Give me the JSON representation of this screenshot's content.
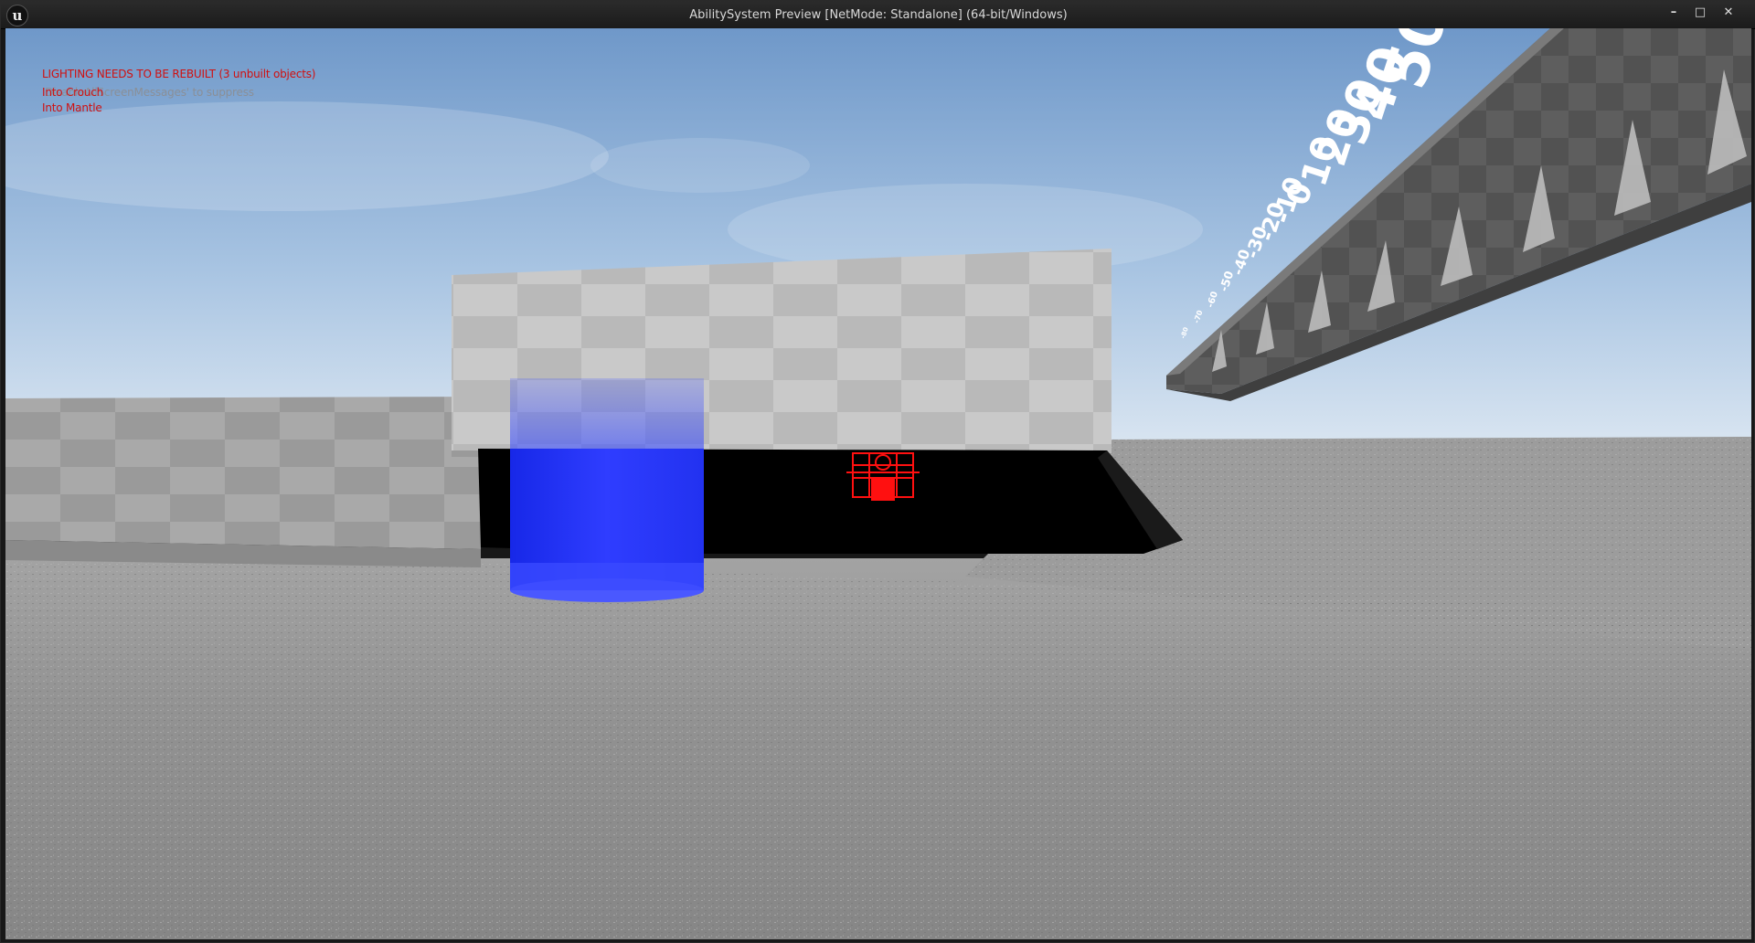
{
  "window": {
    "title": "AbilitySystem Preview [NetMode: Standalone]  (64-bit/Windows)",
    "logo_glyph": "u",
    "controls": {
      "minimize": "–",
      "maximize": "□",
      "close": "✕"
    }
  },
  "screen_messages": {
    "lighting_warning": "LIGHTING NEEDS TO BE REBUILT (3 unbuilt objects)",
    "suppress_hint": "'DisableAllScreenMessages' to suppress",
    "log_lines": [
      "Into Crouch",
      "Into Mantle"
    ]
  },
  "scene": {
    "ruler_labels": [
      "50",
      "40",
      "30",
      "20",
      "10",
      "0",
      "-10",
      "-20",
      "-30",
      "-40",
      "-50",
      "-60",
      "-70",
      "-80"
    ],
    "colors": {
      "sky_top": "#6f98c9",
      "sky_bottom": "#d9e6f2",
      "ground": "#8f8f8f",
      "wall_light": "#c8c8c8",
      "wall_dark": "#a8a8a8",
      "ramp": "#5a5a5a",
      "shadow": "#000000",
      "capsule": "#1a2bff",
      "debug_box": "#ff1010",
      "message_red": "#d01010",
      "message_grey": "#8a8f97"
    }
  }
}
